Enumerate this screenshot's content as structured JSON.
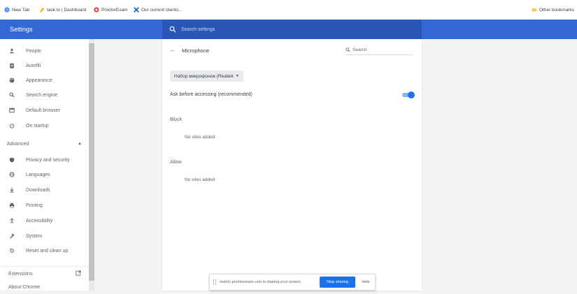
{
  "bookmarks": {
    "items": [
      {
        "label": "New Tab",
        "icon": "chrome-icon"
      },
      {
        "label": "task.to | Dashboard",
        "icon": "task-icon"
      },
      {
        "label": "ProctorExam",
        "icon": "proctorexam-icon"
      },
      {
        "label": "Our current clients...",
        "icon": "puzzle-icon"
      }
    ],
    "other": {
      "label": "Other bookmarks",
      "icon": "folder-icon"
    }
  },
  "header": {
    "title": "Settings",
    "search_placeholder": "Search settings"
  },
  "sidebar": {
    "items": [
      {
        "label": "People",
        "icon": "person-icon"
      },
      {
        "label": "Autofill",
        "icon": "clipboard-icon"
      },
      {
        "label": "Appearance",
        "icon": "palette-icon"
      },
      {
        "label": "Search engine",
        "icon": "search-icon"
      },
      {
        "label": "Default browser",
        "icon": "browser-icon"
      },
      {
        "label": "On startup",
        "icon": "power-icon"
      }
    ],
    "advanced_label": "Advanced",
    "advanced_items": [
      {
        "label": "Privacy and security",
        "icon": "shield-icon"
      },
      {
        "label": "Languages",
        "icon": "globe-icon"
      },
      {
        "label": "Downloads",
        "icon": "download-icon"
      },
      {
        "label": "Printing",
        "icon": "printer-icon"
      },
      {
        "label": "Accessibility",
        "icon": "accessibility-icon"
      },
      {
        "label": "System",
        "icon": "wrench-icon"
      },
      {
        "label": "Reset and clean up",
        "icon": "restore-icon"
      }
    ],
    "extensions_label": "Extensions",
    "about_label": "About Chrome"
  },
  "main": {
    "title": "Microphone",
    "search_placeholder": "Search",
    "device_select": "Набор микрофонов (Realtek",
    "ask_label": "Ask before accessing (recommended)",
    "ask_enabled": true,
    "block_heading": "Block",
    "block_empty": "No sites added",
    "allow_heading": "Allow",
    "allow_empty": "No sites added"
  },
  "share_bar": {
    "message": "webrtc.proctorexam.com is sharing your screen.",
    "stop_label": "Stop sharing",
    "hide_label": "Hide"
  },
  "colors": {
    "header_blue": "#3367d6",
    "search_blue": "#2a56b8",
    "accent": "#1a73e8"
  }
}
